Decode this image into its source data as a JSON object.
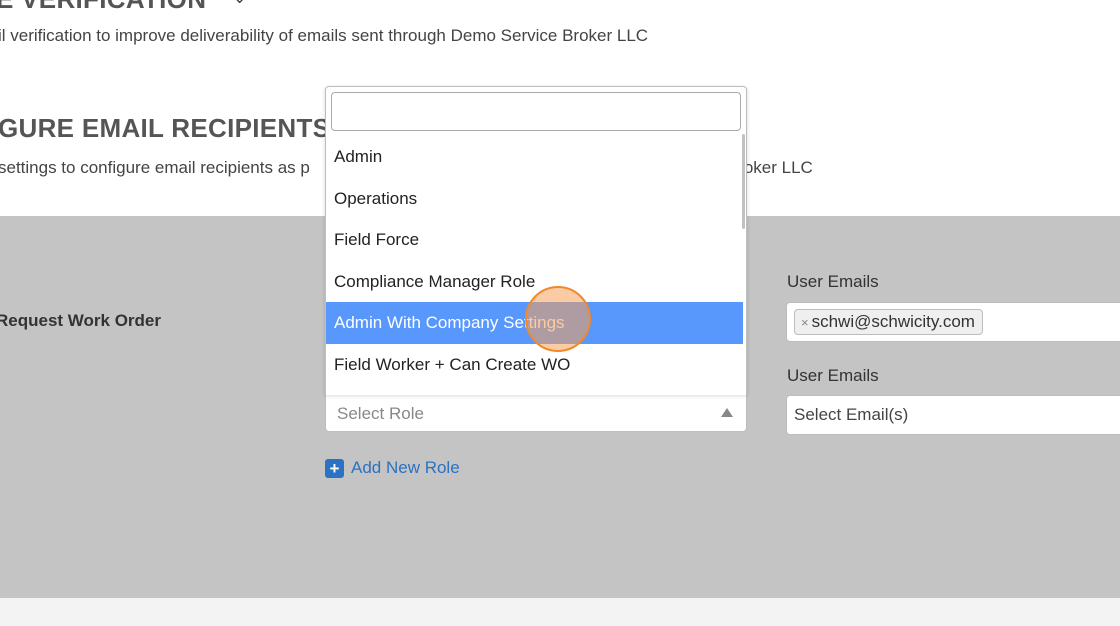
{
  "sections": {
    "verification": {
      "title": "E VERIFICATION",
      "description": "il verification to improve deliverability of emails sent through Demo Service Broker LLC"
    },
    "recipients": {
      "title": "GURE EMAIL RECIPIENTS",
      "description_left": "settings to configure email recipients as p",
      "description_right": "Broker LLC"
    }
  },
  "panel": {
    "row_label": "Request Work Order",
    "role_select": {
      "placeholder": "Select Role"
    },
    "add_role_label": "Add New Role",
    "emails": [
      {
        "label": "User Emails",
        "tags": [
          "schwi@schwicity.com"
        ]
      },
      {
        "label": "User Emails",
        "placeholder": "Select Email(s)"
      }
    ]
  },
  "dropdown": {
    "search_value": "",
    "options": [
      "Admin",
      "Operations",
      "Field Force",
      "Compliance Manager Role",
      "Admin With Company Settings",
      "Field Worker + Can Create WO"
    ],
    "highlighted": "Admin With Company Settings"
  },
  "colors": {
    "panel_bg": "#c4c4c4",
    "highlight": "#5897fb",
    "link": "#2b72c2"
  },
  "icons": {
    "add": "plus-square",
    "tag_remove": "x",
    "select_arrow": "triangle-up"
  }
}
